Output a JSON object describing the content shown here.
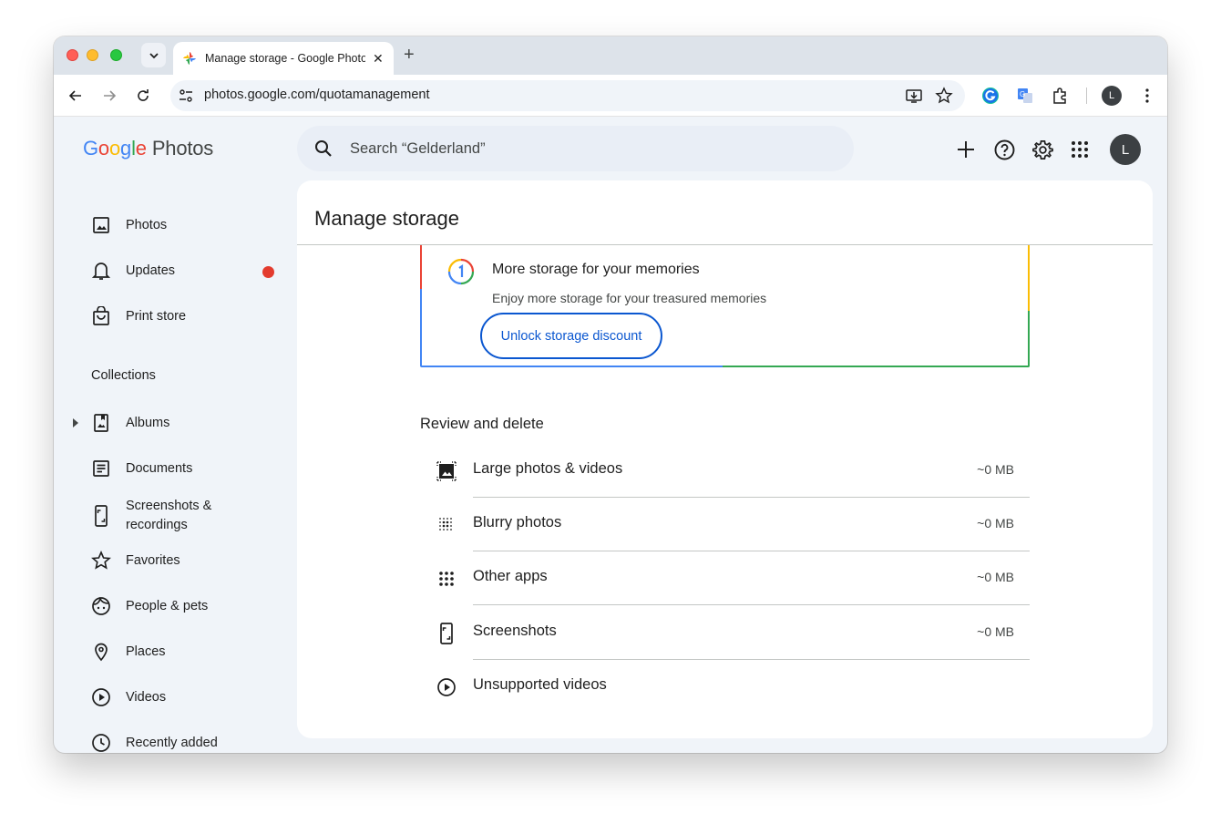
{
  "browser": {
    "tab_title": "Manage storage - Google Photos",
    "url": "photos.google.com/quotamanagement",
    "profile_initial": "L"
  },
  "app": {
    "logo_brand": "Google",
    "logo_product": "Photos",
    "search_placeholder": "Search “Gelderland”",
    "avatar_initial": "L"
  },
  "sidebar": {
    "items": [
      {
        "label": "Photos",
        "icon": "photo-icon"
      },
      {
        "label": "Updates",
        "icon": "bell-icon"
      },
      {
        "label": "Print store",
        "icon": "shopping-bag-icon"
      }
    ],
    "collections_heading": "Collections",
    "collections": [
      {
        "label": "Albums",
        "icon": "album-icon"
      },
      {
        "label": "Documents",
        "icon": "document-icon"
      },
      {
        "label": "Screenshots & recordings",
        "icon": "phone-screenshot-icon"
      },
      {
        "label": "Favorites",
        "icon": "star-icon"
      },
      {
        "label": "People & pets",
        "icon": "face-icon"
      },
      {
        "label": "Places",
        "icon": "location-pin-icon"
      },
      {
        "label": "Videos",
        "icon": "play-circle-icon"
      },
      {
        "label": "Recently added",
        "icon": "clock-icon"
      }
    ]
  },
  "main": {
    "title": "Manage storage",
    "promo": {
      "title": "More storage for your memories",
      "subtitle": "Enjoy more storage for your treasured memories",
      "button": "Unlock storage discount"
    },
    "review": {
      "heading": "Review and delete",
      "rows": [
        {
          "label": "Large photos & videos",
          "size": "~0 MB",
          "icon": "large-photo-icon"
        },
        {
          "label": "Blurry photos",
          "size": "~0 MB",
          "icon": "blur-icon"
        },
        {
          "label": "Other apps",
          "size": "~0 MB",
          "icon": "apps-grid-icon"
        },
        {
          "label": "Screenshots",
          "size": "~0 MB",
          "icon": "phone-screenshot-icon"
        },
        {
          "label": "Unsupported videos",
          "size": "",
          "icon": "play-circle-icon"
        }
      ]
    }
  },
  "colors": {
    "accent": "#0b57d0",
    "notification_dot": "#e33b2e",
    "page_bg": "#f0f4f9"
  }
}
